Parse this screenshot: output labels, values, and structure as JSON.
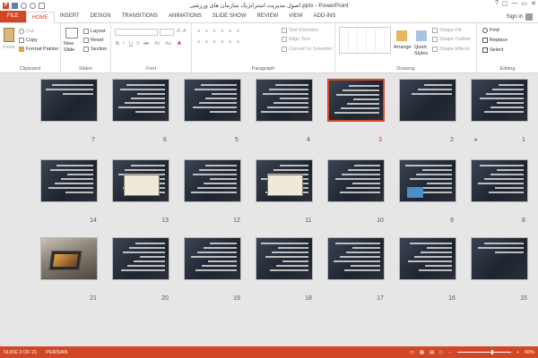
{
  "titlebar": {
    "title": "اصول مدیریت استراتژیک سازمان های ورزشی.pptx - PowerPoint",
    "win_controls": [
      "?",
      "▢",
      "—",
      "▭",
      "✕"
    ]
  },
  "tabs": [
    "FILE",
    "HOME",
    "INSERT",
    "DESIGN",
    "TRANSITIONS",
    "ANIMATIONS",
    "SLIDE SHOW",
    "REVIEW",
    "VIEW",
    "ADD-INS"
  ],
  "active_tab": "HOME",
  "signin": "Sign in",
  "ribbon": {
    "clipboard": {
      "label": "Clipboard",
      "paste": "Paste",
      "cut": "Cut",
      "copy": "Copy",
      "format_painter": "Format Painter"
    },
    "slides": {
      "label": "Slides",
      "new_slide": "New Slide",
      "layout": "Layout",
      "reset": "Reset",
      "section": "Section"
    },
    "font": {
      "label": "Font",
      "size_value": ""
    },
    "paragraph": {
      "label": "Paragraph",
      "text_direction": "Text Direction",
      "align_text": "Align Text",
      "convert_smartart": "Convert to SmartArt"
    },
    "drawing": {
      "label": "Drawing",
      "arrange": "Arrange",
      "quick_styles": "Quick Styles",
      "shape_fill": "Shape Fill",
      "shape_outline": "Shape Outline",
      "shape_effects": "Shape Effects"
    },
    "editing": {
      "label": "Editing",
      "find": "Find",
      "replace": "Replace",
      "select": "Select"
    }
  },
  "slides": [
    {
      "n": "1",
      "star": "★"
    },
    {
      "n": "2"
    },
    {
      "n": "3"
    },
    {
      "n": "4"
    },
    {
      "n": "5"
    },
    {
      "n": "6"
    },
    {
      "n": "7"
    },
    {
      "n": "8"
    },
    {
      "n": "9"
    },
    {
      "n": "10"
    },
    {
      "n": "11"
    },
    {
      "n": "12"
    },
    {
      "n": "13"
    },
    {
      "n": "14"
    },
    {
      "n": "15"
    },
    {
      "n": "16"
    },
    {
      "n": "17"
    },
    {
      "n": "18"
    },
    {
      "n": "19"
    },
    {
      "n": "20"
    },
    {
      "n": "21"
    }
  ],
  "selected_slide": "3",
  "status": {
    "slide_info": "SLIDE 3 OF 21",
    "language": "PERSIAN",
    "zoom": "66%"
  },
  "colors": {
    "accent": "#d24726",
    "sorter_bg": "#e6e6e6"
  }
}
